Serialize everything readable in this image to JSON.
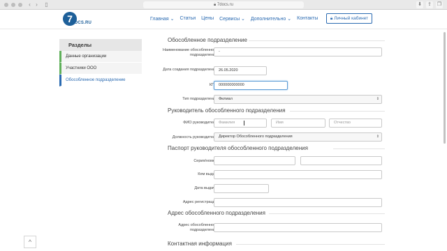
{
  "browser": {
    "url": "7docs.ru"
  },
  "header": {
    "logo_text": "DOCS.RU",
    "nav": [
      "Главная ⌄",
      "Статьи",
      "Цены",
      "Сервисы ⌄",
      "Дополнительно ⌄",
      "Контакты"
    ],
    "cabinet_label": "Личный кабинет"
  },
  "sidebar": {
    "title": "Разделы",
    "items": [
      "Данные организации",
      "Участники ООО",
      "Обособленное подразделение"
    ]
  },
  "form": {
    "section1_title": "Обособленное подразделение",
    "name_label": "Наименование обособленного подразделения",
    "name_value": "-",
    "date_label": "Дата создания подразделения",
    "date_value": "26.05.2020",
    "kpp_label": "КПП",
    "kpp_value": "000000000000",
    "type_label": "Тип подразделения",
    "type_value": "Филиал",
    "section2_title": "Руководитель обособленного подразделения",
    "fio_label": "ФИО руководителя",
    "surname_placeholder": "Фамилия",
    "firstname_placeholder": "Имя",
    "patronymic_placeholder": "Отчество",
    "position_label": "Должность руководителя",
    "position_value": "Директор Обособленного подразделения",
    "section3_title": "Паспорт руководителя обособленного подразделения",
    "series_label": "Серия/номер",
    "issued_by_label": "Кем выдан",
    "issue_date_label": "Дата выдачи",
    "reg_address_label": "Адрес регистрации",
    "section4_title": "Адрес обособленного подразделения",
    "unit_address_label": "Адрес обособленного подразделения",
    "section5_title": "Контактная информация"
  }
}
